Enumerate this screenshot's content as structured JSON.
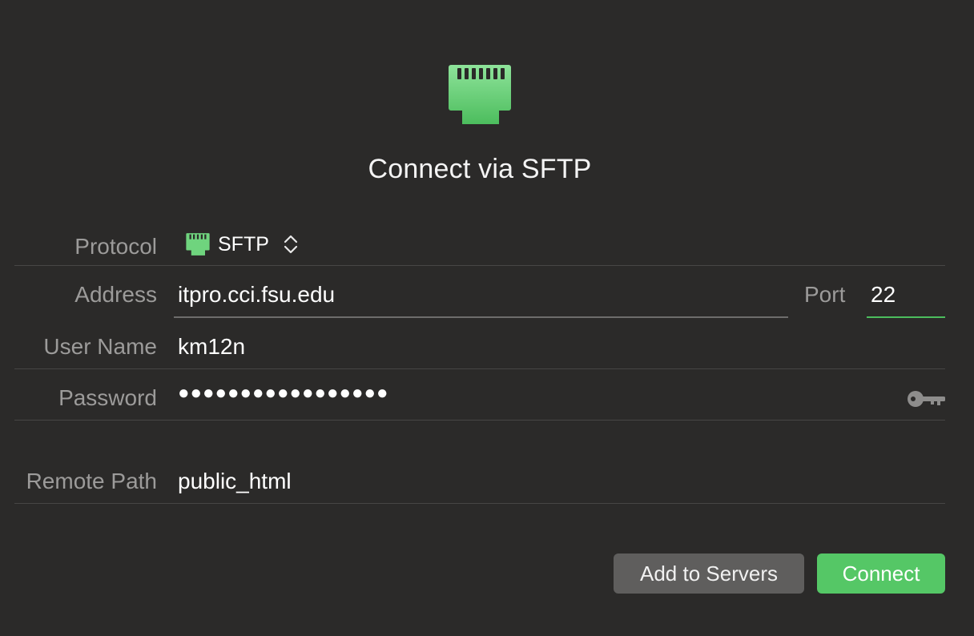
{
  "dialog": {
    "title": "Connect via SFTP",
    "hero_icon": "ethernet-port-icon",
    "accent_color": "#55c766"
  },
  "form": {
    "protocol": {
      "label": "Protocol",
      "value": "SFTP",
      "icon": "ethernet-port-icon"
    },
    "address": {
      "label": "Address",
      "value": "itpro.cci.fsu.edu"
    },
    "port": {
      "label": "Port",
      "value": "22"
    },
    "user_name": {
      "label": "User Name",
      "value": "km12n"
    },
    "password": {
      "label": "Password",
      "masked_value": "●●●●●●●●●●●●●●●●●",
      "icon": "key-icon"
    },
    "remote_path": {
      "label": "Remote Path",
      "value": "public_html"
    }
  },
  "buttons": {
    "add_to_servers": "Add to Servers",
    "connect": "Connect"
  }
}
